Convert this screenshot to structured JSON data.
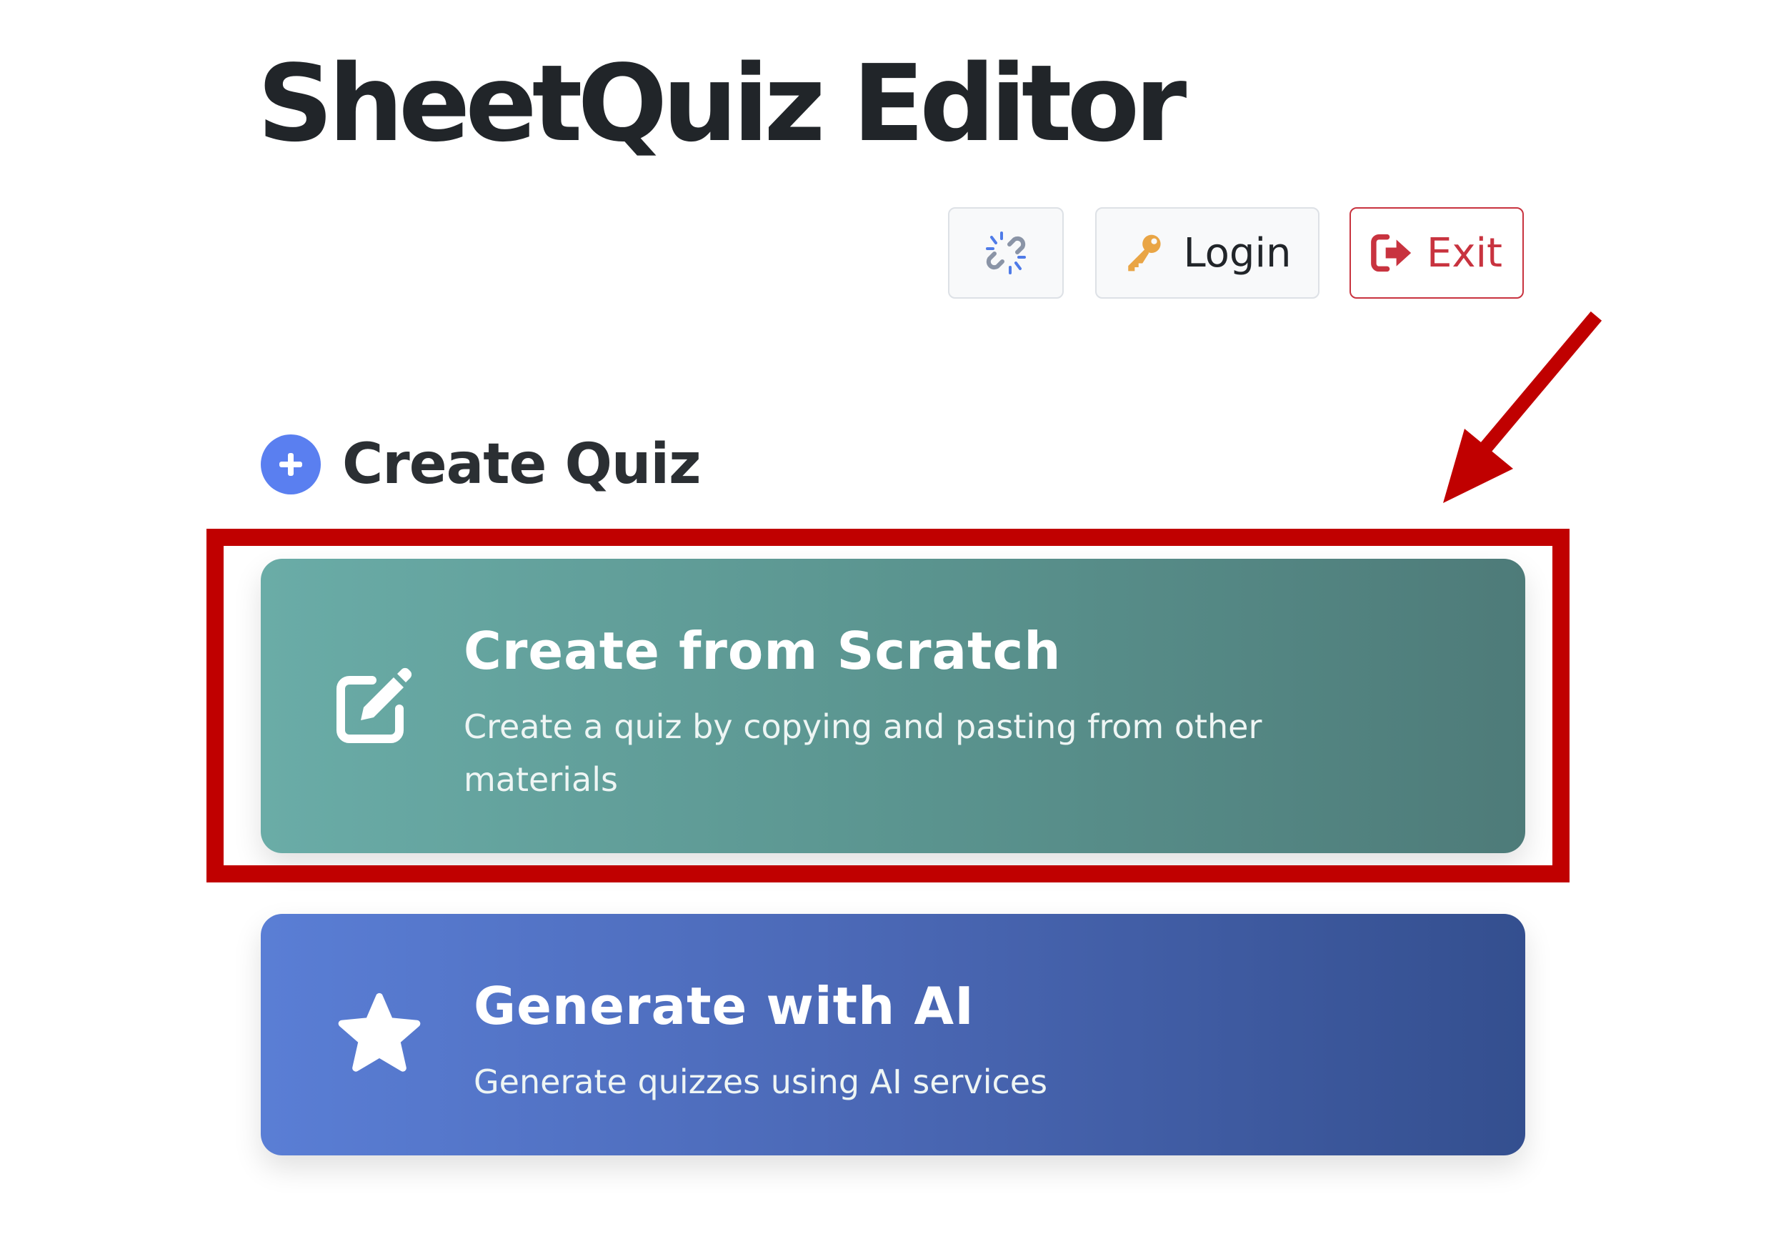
{
  "header": {
    "title": "SheetQuiz Editor"
  },
  "toolbar": {
    "link_icon": "broken-link-icon",
    "login_label": "Login",
    "login_icon": "key-icon",
    "exit_label": "Exit",
    "exit_icon": "sign-out-icon"
  },
  "section": {
    "title": "Create Quiz",
    "icon": "plus-circle-icon"
  },
  "cards": [
    {
      "title": "Create from Scratch",
      "description": "Create a quiz by copying and pasting from other materials",
      "icon": "edit-icon"
    },
    {
      "title": "Generate with AI",
      "description": "Generate quizzes using AI services",
      "icon": "star-icon"
    }
  ],
  "annotation": {
    "color": "#c00000",
    "highlight": "Create from Scratch card",
    "arrow_direction": "down-left"
  },
  "colors": {
    "scratch_card_start": "#6aaca7",
    "scratch_card_end": "#4e7b79",
    "ai_card_start": "#5a7ed5",
    "ai_card_end": "#344f8f",
    "primary": "#5a7ff0",
    "danger": "#c8333f"
  }
}
